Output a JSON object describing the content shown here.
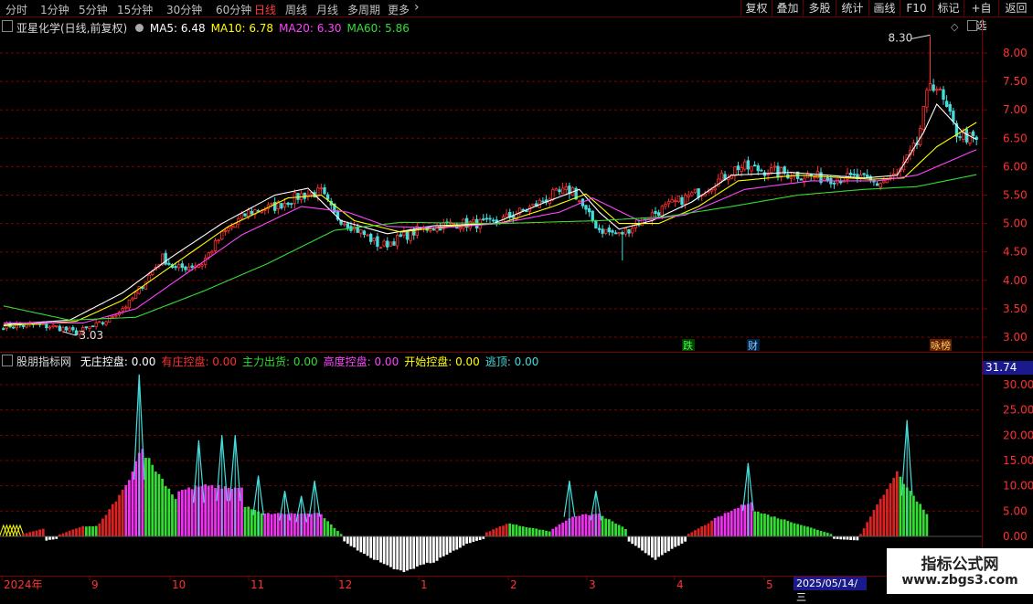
{
  "toolbar": {
    "timeframes": [
      "分时",
      "1分钟",
      "5分钟",
      "15分钟",
      "30分钟",
      "60分钟",
      "日线",
      "周线",
      "月线",
      "多周期",
      "更多"
    ],
    "active": "日线",
    "right_tools": [
      "复权",
      "叠加",
      "多股",
      "统计",
      "画线",
      "F10",
      "标记",
      "+自选",
      "返回"
    ]
  },
  "main_legend": {
    "title": "亚星化学(日线,前复权)",
    "ma": [
      {
        "label": "MA5:",
        "value": "6.48",
        "color": "#ffffff"
      },
      {
        "label": "MA10:",
        "value": "6.78",
        "color": "#ffff00"
      },
      {
        "label": "MA20:",
        "value": "6.30",
        "color": "#ff44ff"
      },
      {
        "label": "MA60:",
        "value": "5.86",
        "color": "#33dd33"
      }
    ]
  },
  "sub_legend": {
    "title": "股朋指标网",
    "items": [
      {
        "label": "无庄控盘:",
        "value": "0.00",
        "color": "#ffffff"
      },
      {
        "label": "有庄控盘:",
        "value": "0.00",
        "color": "#ff3030"
      },
      {
        "label": "主力出货:",
        "value": "0.00",
        "color": "#33dd33"
      },
      {
        "label": "高度控盘:",
        "value": "0.00",
        "color": "#ff44ff"
      },
      {
        "label": "开始控盘:",
        "value": "0.00",
        "color": "#ffff00"
      },
      {
        "label": "逃顶:",
        "value": "0.00",
        "color": "#44dddd"
      }
    ]
  },
  "annotations": {
    "high": "8.30",
    "low": "3.03",
    "markers": [
      {
        "text": "跌",
        "color": "#44ff44",
        "bg": "#004400"
      },
      {
        "text": "财",
        "color": "#88ccff",
        "bg": "#002244"
      },
      {
        "text": "咏榜",
        "color": "#ffcc66",
        "bg": "#662200"
      }
    ],
    "sub_current": "31.74",
    "cursor_date": "2025/05/14/三"
  },
  "watermark": {
    "line1": "指标公式网",
    "line2": "www.zbgs3.com"
  },
  "colors": {
    "up": "#ff3030",
    "down": "#44dddd",
    "grid": "#7a0000",
    "axis_text": "#ff3030"
  },
  "chart_data": [
    {
      "type": "candlestick",
      "title": "亚星化学(日线,前复权)",
      "y_ticks": [
        3.0,
        3.5,
        4.0,
        4.5,
        5.0,
        5.5,
        6.0,
        6.5,
        7.0,
        7.5,
        8.0
      ],
      "ylim": [
        2.9,
        8.8
      ],
      "x_labels": [
        "2024年",
        "9",
        "10",
        "11",
        "12",
        "1",
        "2",
        "3",
        "4",
        "5"
      ],
      "grid": true,
      "series": [
        {
          "name": "MA5",
          "color": "#ffffff",
          "anchors": [
            [
              0,
              3.22
            ],
            [
              20,
              3.3
            ],
            [
              36,
              3.78
            ],
            [
              50,
              4.38
            ],
            [
              66,
              5.0
            ],
            [
              82,
              5.5
            ],
            [
              92,
              5.62
            ],
            [
              102,
              5.05
            ],
            [
              116,
              4.82
            ],
            [
              130,
              4.96
            ],
            [
              148,
              5.0
            ],
            [
              164,
              5.38
            ],
            [
              174,
              5.6
            ],
            [
              180,
              5.2
            ],
            [
              186,
              4.9
            ],
            [
              196,
              5.05
            ],
            [
              208,
              5.38
            ],
            [
              220,
              5.85
            ],
            [
              238,
              5.9
            ],
            [
              260,
              5.8
            ],
            [
              270,
              5.85
            ],
            [
              278,
              6.6
            ],
            [
              282,
              7.1
            ],
            [
              290,
              6.6
            ],
            [
              294,
              6.48
            ]
          ]
        },
        {
          "name": "MA10",
          "color": "#ffff00",
          "anchors": [
            [
              0,
              3.2
            ],
            [
              22,
              3.28
            ],
            [
              36,
              3.65
            ],
            [
              52,
              4.3
            ],
            [
              68,
              4.95
            ],
            [
              86,
              5.45
            ],
            [
              96,
              5.5
            ],
            [
              106,
              5.05
            ],
            [
              120,
              4.85
            ],
            [
              134,
              4.95
            ],
            [
              150,
              5.0
            ],
            [
              166,
              5.3
            ],
            [
              176,
              5.52
            ],
            [
              186,
              5.0
            ],
            [
              198,
              5.0
            ],
            [
              210,
              5.3
            ],
            [
              222,
              5.75
            ],
            [
              240,
              5.85
            ],
            [
              262,
              5.78
            ],
            [
              272,
              5.8
            ],
            [
              282,
              6.35
            ],
            [
              294,
              6.78
            ]
          ]
        },
        {
          "name": "MA20",
          "color": "#ff44ff",
          "anchors": [
            [
              0,
              3.25
            ],
            [
              24,
              3.25
            ],
            [
              40,
              3.5
            ],
            [
              56,
              4.15
            ],
            [
              72,
              4.8
            ],
            [
              90,
              5.3
            ],
            [
              104,
              5.2
            ],
            [
              116,
              4.95
            ],
            [
              132,
              4.92
            ],
            [
              150,
              5.0
            ],
            [
              168,
              5.2
            ],
            [
              178,
              5.45
            ],
            [
              192,
              5.05
            ],
            [
              206,
              5.15
            ],
            [
              224,
              5.6
            ],
            [
              244,
              5.75
            ],
            [
              264,
              5.75
            ],
            [
              276,
              5.85
            ],
            [
              286,
              6.1
            ],
            [
              294,
              6.3
            ]
          ]
        },
        {
          "name": "MA60",
          "color": "#33dd33",
          "anchors": [
            [
              0,
              3.55
            ],
            [
              20,
              3.3
            ],
            [
              40,
              3.35
            ],
            [
              60,
              3.8
            ],
            [
              80,
              4.3
            ],
            [
              100,
              4.88
            ],
            [
              120,
              5.02
            ],
            [
              150,
              5.0
            ],
            [
              180,
              5.05
            ],
            [
              200,
              5.12
            ],
            [
              220,
              5.3
            ],
            [
              240,
              5.5
            ],
            [
              260,
              5.6
            ],
            [
              276,
              5.65
            ],
            [
              294,
              5.86
            ]
          ]
        }
      ],
      "close_anchors": [
        [
          0,
          3.2
        ],
        [
          8,
          3.22
        ],
        [
          16,
          3.18
        ],
        [
          22,
          3.08
        ],
        [
          30,
          3.25
        ],
        [
          38,
          3.6
        ],
        [
          48,
          4.4
        ],
        [
          52,
          4.2
        ],
        [
          60,
          4.3
        ],
        [
          66,
          4.8
        ],
        [
          74,
          5.2
        ],
        [
          82,
          5.3
        ],
        [
          90,
          5.5
        ],
        [
          96,
          5.55
        ],
        [
          100,
          5.15
        ],
        [
          108,
          4.85
        ],
        [
          114,
          4.6
        ],
        [
          118,
          4.7
        ],
        [
          126,
          4.9
        ],
        [
          136,
          5.0
        ],
        [
          148,
          5.0
        ],
        [
          160,
          5.3
        ],
        [
          166,
          5.5
        ],
        [
          172,
          5.6
        ],
        [
          176,
          5.2
        ],
        [
          180,
          4.9
        ],
        [
          186,
          4.8
        ],
        [
          194,
          5.1
        ],
        [
          204,
          5.4
        ],
        [
          212,
          5.6
        ],
        [
          222,
          6.0
        ],
        [
          234,
          5.9
        ],
        [
          248,
          5.8
        ],
        [
          258,
          5.8
        ],
        [
          264,
          5.7
        ],
        [
          270,
          5.85
        ],
        [
          276,
          6.4
        ],
        [
          280,
          7.5
        ],
        [
          282,
          7.4
        ],
        [
          288,
          6.6
        ],
        [
          294,
          6.45
        ]
      ],
      "n_bars": 295,
      "high": 8.3,
      "low": 3.03
    },
    {
      "type": "bar",
      "title": "股朋指标网",
      "y_ticks": [
        0.0,
        5.0,
        10.0,
        15.0,
        20.0,
        25.0,
        30.0
      ],
      "ylim": [
        -7,
        31.74
      ],
      "current": 31.74,
      "n_bars": 295,
      "segments": [
        {
          "kind": "white",
          "from": 0,
          "to": 5,
          "anchors": [
            [
              0,
              0.2
            ],
            [
              5,
              0.2
            ]
          ]
        },
        {
          "kind": "red",
          "from": 6,
          "to": 12,
          "anchors": [
            [
              6,
              0.5
            ],
            [
              12,
              1.5
            ]
          ]
        },
        {
          "kind": "white",
          "from": 13,
          "to": 16,
          "anchors": [
            [
              13,
              -0.8
            ],
            [
              16,
              -0.5
            ]
          ]
        },
        {
          "kind": "red",
          "from": 17,
          "to": 24,
          "anchors": [
            [
              17,
              0.4
            ],
            [
              24,
              2
            ]
          ]
        },
        {
          "kind": "green",
          "from": 25,
          "to": 28,
          "anchors": [
            [
              25,
              2
            ],
            [
              28,
              2
            ]
          ]
        },
        {
          "kind": "red",
          "from": 29,
          "to": 36,
          "anchors": [
            [
              29,
              2.5
            ],
            [
              36,
              9
            ]
          ]
        },
        {
          "kind": "magenta",
          "from": 37,
          "to": 42,
          "anchors": [
            [
              37,
              10
            ],
            [
              42,
              18
            ]
          ]
        },
        {
          "kind": "green",
          "from": 43,
          "to": 52,
          "anchors": [
            [
              43,
              16
            ],
            [
              52,
              7.5
            ]
          ]
        },
        {
          "kind": "magenta",
          "from": 53,
          "to": 72,
          "anchors": [
            [
              53,
              9
            ],
            [
              60,
              10
            ],
            [
              72,
              9.5
            ]
          ]
        },
        {
          "kind": "green",
          "from": 73,
          "to": 78,
          "anchors": [
            [
              73,
              6
            ],
            [
              78,
              4.5
            ]
          ]
        },
        {
          "kind": "magenta",
          "from": 79,
          "to": 96,
          "anchors": [
            [
              79,
              4.5
            ],
            [
              96,
              4.5
            ]
          ]
        },
        {
          "kind": "green",
          "from": 97,
          "to": 102,
          "anchors": [
            [
              97,
              3.5
            ],
            [
              102,
              0.5
            ]
          ]
        },
        {
          "kind": "white",
          "from": 103,
          "to": 145,
          "anchors": [
            [
              103,
              -1
            ],
            [
              110,
              -4
            ],
            [
              120,
              -7
            ],
            [
              130,
              -5
            ],
            [
              140,
              -1.5
            ],
            [
              145,
              -0.5
            ]
          ]
        },
        {
          "kind": "red",
          "from": 146,
          "to": 152,
          "anchors": [
            [
              146,
              0.8
            ],
            [
              152,
              2.5
            ]
          ]
        },
        {
          "kind": "green",
          "from": 153,
          "to": 165,
          "anchors": [
            [
              153,
              2.5
            ],
            [
              165,
              1
            ]
          ]
        },
        {
          "kind": "magenta",
          "from": 166,
          "to": 180,
          "anchors": [
            [
              166,
              1.5
            ],
            [
              172,
              4
            ],
            [
              180,
              4.5
            ]
          ]
        },
        {
          "kind": "green",
          "from": 181,
          "to": 188,
          "anchors": [
            [
              181,
              4
            ],
            [
              188,
              1.5
            ]
          ]
        },
        {
          "kind": "white",
          "from": 189,
          "to": 206,
          "anchors": [
            [
              189,
              -1
            ],
            [
              197,
              -4.5
            ],
            [
              206,
              -1
            ]
          ]
        },
        {
          "kind": "red",
          "from": 207,
          "to": 214,
          "anchors": [
            [
              207,
              0.5
            ],
            [
              214,
              3
            ]
          ]
        },
        {
          "kind": "magenta",
          "from": 215,
          "to": 226,
          "anchors": [
            [
              215,
              3.5
            ],
            [
              226,
              7
            ]
          ]
        },
        {
          "kind": "green",
          "from": 227,
          "to": 250,
          "anchors": [
            [
              227,
              5
            ],
            [
              240,
              2.5
            ],
            [
              250,
              0.5
            ]
          ]
        },
        {
          "kind": "white",
          "from": 251,
          "to": 258,
          "anchors": [
            [
              251,
              -0.5
            ],
            [
              258,
              -0.8
            ]
          ]
        },
        {
          "kind": "red",
          "from": 259,
          "to": 270,
          "anchors": [
            [
              259,
              0.5
            ],
            [
              270,
              13
            ]
          ]
        },
        {
          "kind": "green",
          "from": 271,
          "to": 279,
          "anchors": [
            [
              271,
              11.5
            ],
            [
              279,
              4.5
            ]
          ]
        }
      ],
      "spikes": [
        {
          "i": 41,
          "v": 32.0,
          "color": "#44dddd"
        },
        {
          "i": 59,
          "v": 19.0,
          "color": "#44dddd"
        },
        {
          "i": 66,
          "v": 20.0,
          "color": "#44dddd"
        },
        {
          "i": 70,
          "v": 20.0,
          "color": "#44dddd"
        },
        {
          "i": 77,
          "v": 12.0,
          "color": "#44dddd"
        },
        {
          "i": 85,
          "v": 9.0,
          "color": "#44dddd"
        },
        {
          "i": 90,
          "v": 8.0,
          "color": "#44dddd"
        },
        {
          "i": 94,
          "v": 11.0,
          "color": "#44dddd"
        },
        {
          "i": 171,
          "v": 11.0,
          "color": "#44dddd"
        },
        {
          "i": 179,
          "v": 9.0,
          "color": "#44dddd"
        },
        {
          "i": 225,
          "v": 14.5,
          "color": "#44dddd"
        },
        {
          "i": 273,
          "v": 23.0,
          "color": "#44dddd"
        }
      ]
    }
  ]
}
